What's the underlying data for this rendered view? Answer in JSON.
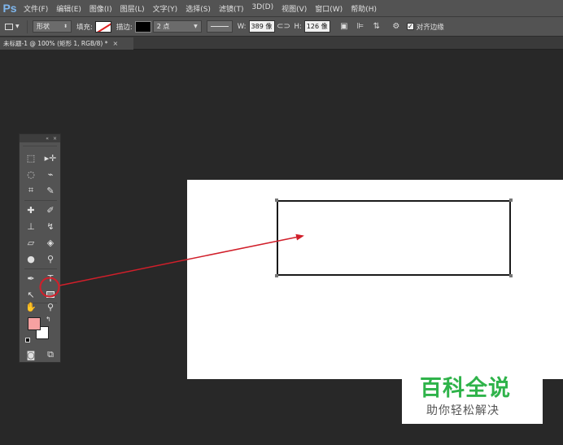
{
  "app": {
    "logo": "Ps"
  },
  "menu": [
    "文件(F)",
    "编辑(E)",
    "图像(I)",
    "图层(L)",
    "文字(Y)",
    "选择(S)",
    "滤镜(T)",
    "3D(D)",
    "视图(V)",
    "窗口(W)",
    "帮助(H)"
  ],
  "options": {
    "mode_value": "形状",
    "fill_label": "填充:",
    "stroke_label": "描边:",
    "stroke_width_value": "2 点",
    "w_label": "W:",
    "w_value": "389 像",
    "h_label": "H:",
    "h_value": "126 像",
    "align_edges_label": "对齐边缘",
    "align_edges_checked": true
  },
  "document": {
    "tab_title": "未标题-1 @ 100% (矩形 1, RGB/8) *",
    "close_glyph": "×"
  },
  "tools": {
    "header_icons": [
      "«",
      "×"
    ],
    "foreground_color": "#f7a1a1",
    "background_color": "#ffffff",
    "highlighted_tool": "rectangle-tool"
  },
  "annotation": {
    "highlight_color": "#d11f2a",
    "arrow_color": "#d11f2a"
  },
  "watermark": {
    "title": "百科全说",
    "subtitle": "助你轻松解决",
    "title_color": "#2fb34a"
  }
}
